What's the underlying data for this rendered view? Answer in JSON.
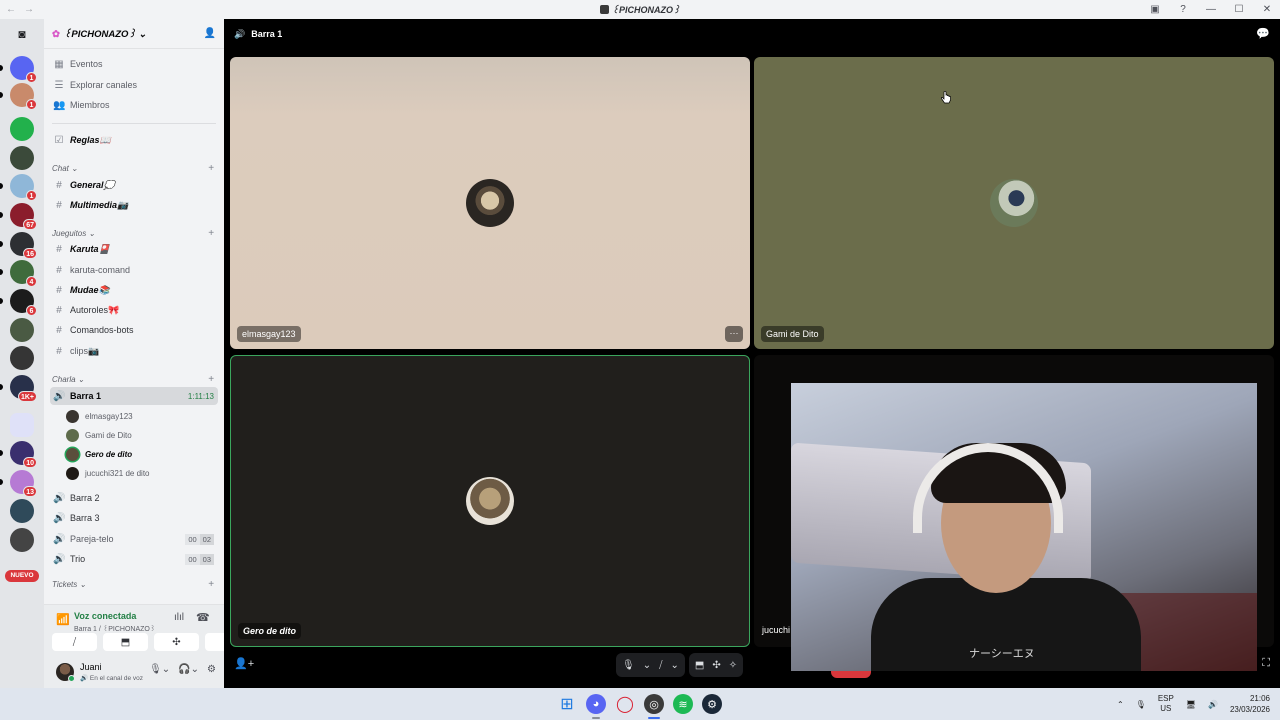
{
  "window": {
    "title": "꒰PICHONAZO꒱",
    "nav_back": "←",
    "nav_forward": "→",
    "controls": [
      "▣",
      "?",
      "—",
      "☐",
      "✕"
    ]
  },
  "rail": {
    "nuevo": "NUEVO",
    "servers": [
      {
        "color": "#1e1f22",
        "icon": "discord-home",
        "badge": ""
      },
      {
        "color": "#5865f2",
        "badge": "1"
      },
      {
        "color": "#c98a6b",
        "badge": "1"
      },
      {
        "color": "#22b14c",
        "badge": ""
      },
      {
        "color": "#3b4a3a",
        "badge": ""
      },
      {
        "color": "#8fb7d8",
        "badge": "1"
      },
      {
        "color": "#8b1d2c",
        "badge": "67"
      },
      {
        "color": "#2d2f33",
        "badge": "16"
      },
      {
        "color": "#3f6b3c",
        "badge": "4"
      },
      {
        "color": "#1c1c1c",
        "badge": "6"
      },
      {
        "color": "#4a5a43",
        "badge": ""
      },
      {
        "color": "#353535",
        "badge": ""
      },
      {
        "color": "#28304a",
        "badge": "1K+"
      },
      {
        "color": "#5865f2",
        "badge": ""
      },
      {
        "color": "#3a2f6e",
        "badge": "10"
      },
      {
        "color": "#b67ad4",
        "badge": "13"
      },
      {
        "color": "#2f4a5a",
        "badge": ""
      },
      {
        "color": "#444444",
        "badge": ""
      }
    ]
  },
  "guild": {
    "name": "꒰PICHONAZO꒱",
    "top_items": [
      "Eventos",
      "Explorar canales",
      "Miembros"
    ],
    "rules": "Reglas📖",
    "categories": {
      "chat": "Chat",
      "jueguitos": "Jueguitos",
      "charla": "Charla",
      "tickets": "Tickets"
    },
    "chat_channels": [
      "General💭",
      "Multimedia📷"
    ],
    "game_channels": [
      "Karuta🎴",
      "karuta-comand",
      "Mudae📚",
      "Autoroles🎀",
      "Comandos-bots",
      "clips📷"
    ],
    "voice": {
      "active": "Barra 1",
      "active_time": "1:11:13",
      "users": [
        "elmasgay123",
        "Gami de Dito",
        "Gero de dito",
        "jucuchi321 de dito"
      ],
      "others": [
        {
          "name": "Barra 2",
          "counts": []
        },
        {
          "name": "Barra 3",
          "counts": []
        },
        {
          "name": "Pareja-telo",
          "counts": [
            "00",
            "02"
          ]
        },
        {
          "name": "Trio",
          "counts": [
            "00",
            "03"
          ]
        }
      ]
    }
  },
  "voice_panel": {
    "status": "Voz conectada",
    "sub": "Barra 1 / ꒰PICHONAZO꒱"
  },
  "user": {
    "name": "Juani",
    "status": "🔊 En el canal de voz"
  },
  "call": {
    "channel": "Barra 1",
    "tiles": [
      "elmasgay123",
      "Gami de Dito",
      "Gero de dito",
      "jucuchi"
    ],
    "more": "···",
    "shirt_print": "ナーシーエヌ"
  },
  "taskbar": {
    "lang_top": "ESP",
    "lang_bottom": "US",
    "time": "21:06",
    "date": "23/03/2026"
  },
  "colors": {
    "connected": "#248046",
    "speaking_border": "#3ba55d",
    "danger": "#da373c"
  }
}
